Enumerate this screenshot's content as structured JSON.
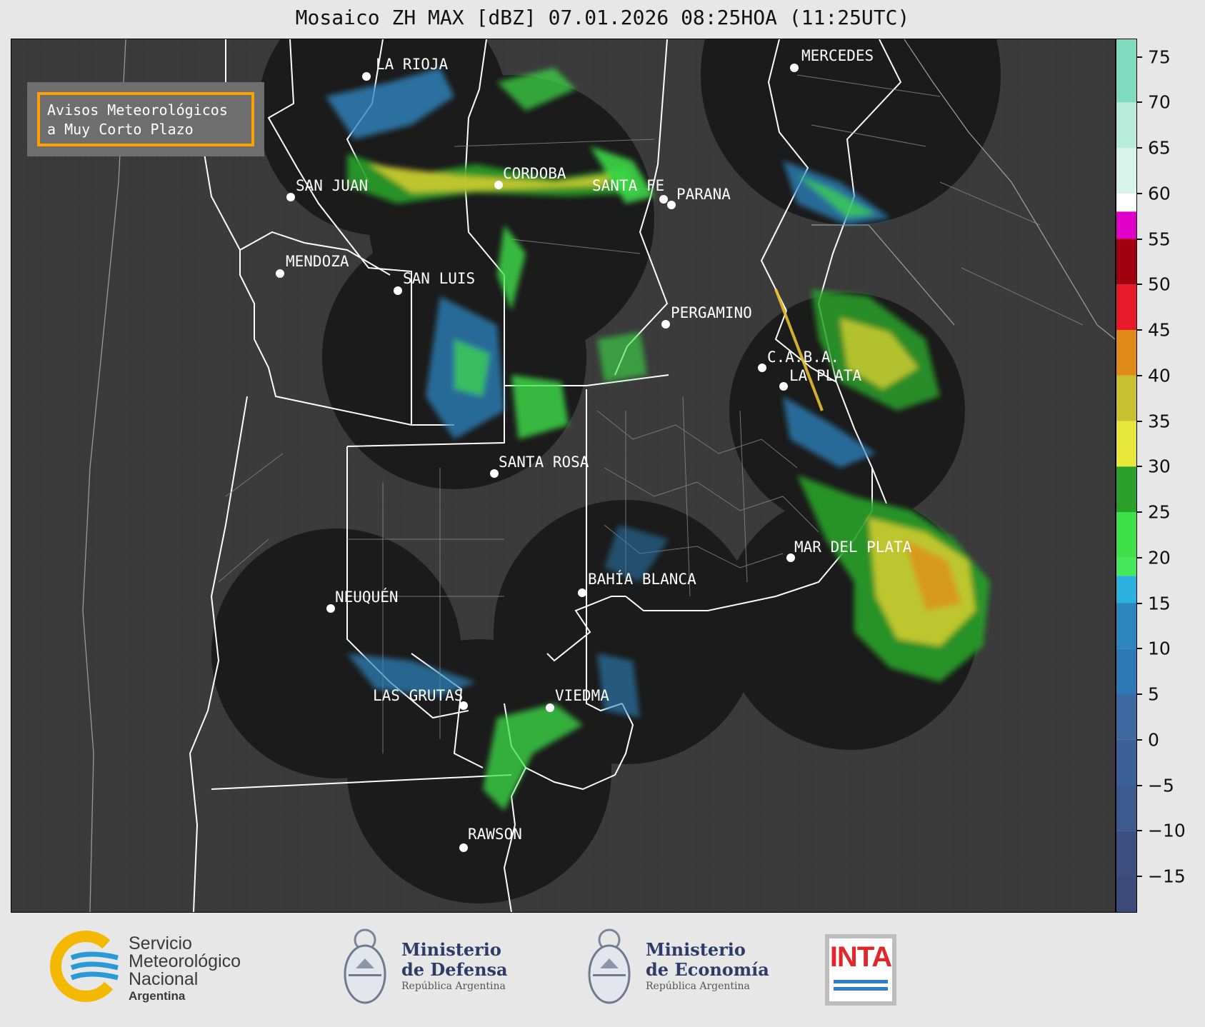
{
  "title": "Mosaico ZH MAX [dBZ] 07.01.2026 08:25HOA (11:25UTC)",
  "notice": {
    "line1": "Avisos Meteorológicos",
    "line2": "a Muy Corto Plazo",
    "border_color": "#ffa000"
  },
  "colorbar": {
    "unit": "dBZ",
    "ticks": [
      "75",
      "70",
      "65",
      "60",
      "55",
      "50",
      "45",
      "40",
      "35",
      "30",
      "25",
      "20",
      "15",
      "10",
      "5",
      "0",
      "−5",
      "−10",
      "−15"
    ],
    "colors": {
      "-15": "#3c4a7a",
      "0": "#3c6aa0",
      "10": "#2e86c1",
      "15": "#2bb0e0",
      "20": "#3ee04a",
      "25": "#2aa02a",
      "30": "#e8e83a",
      "35": "#c9c230",
      "40": "#e08a1a",
      "45": "#e81a2a",
      "50": "#a00010",
      "55": "#e000c8",
      "60": "#ffffff",
      "70": "#a0e8cf",
      "75": "#80dcc0"
    }
  },
  "cities": [
    {
      "name": "LA RIOJA"
    },
    {
      "name": "MERCEDES"
    },
    {
      "name": "CORDOBA"
    },
    {
      "name": "SAN JUAN"
    },
    {
      "name": "SANTA FE"
    },
    {
      "name": "PARANA"
    },
    {
      "name": "MENDOZA"
    },
    {
      "name": "SAN LUIS"
    },
    {
      "name": "PERGAMINO"
    },
    {
      "name": "C.A.B.A."
    },
    {
      "name": "LA PLATA"
    },
    {
      "name": "SANTA ROSA"
    },
    {
      "name": "MAR DEL PLATA"
    },
    {
      "name": "BAHÍA BLANCA"
    },
    {
      "name": "NEUQUÉN"
    },
    {
      "name": "LAS GRUTAS"
    },
    {
      "name": "VIEDMA"
    },
    {
      "name": "RAWSON"
    }
  ],
  "footer": {
    "smn": {
      "line1": "Servicio",
      "line2": "Meteorológico",
      "line3": "Nacional",
      "line4": "Argentina"
    },
    "defensa": {
      "line1": "Ministerio",
      "line2": "de Defensa",
      "line3": "República Argentina"
    },
    "economia": {
      "line1": "Ministerio",
      "line2": "de Economía",
      "line3": "República Argentina"
    },
    "inta": {
      "text": "INTA"
    }
  }
}
